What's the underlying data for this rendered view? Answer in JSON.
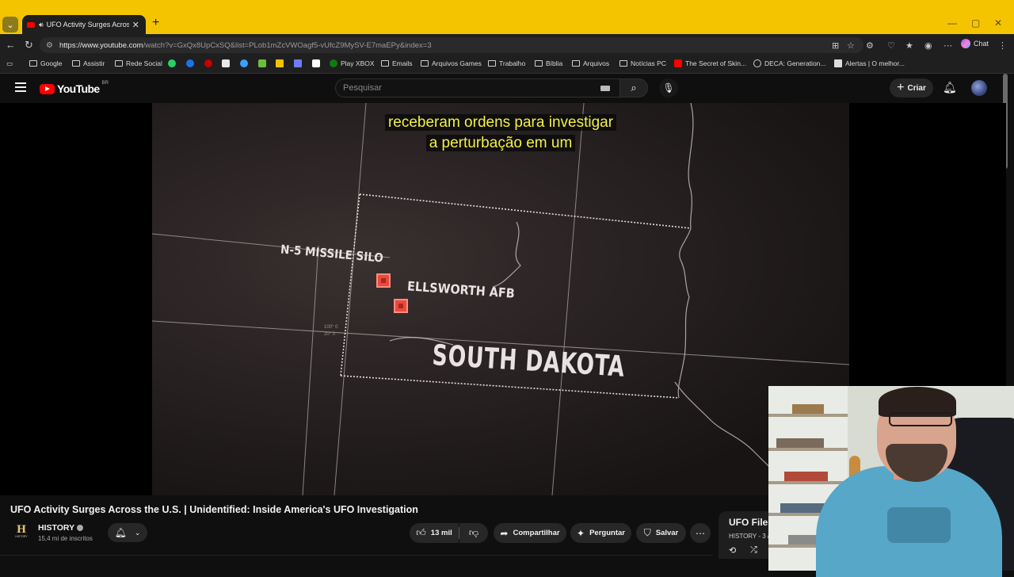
{
  "browser": {
    "tab_title": "UFO Activity Surges Across the",
    "tab_close": "✕",
    "new_tab": "+",
    "url_host": "https://www.youtube.com",
    "url_path": "/watch?v=GxQx8UpCxSQ&list=PLob1mZcVWOagf5-vUfcZ9MySV-E7maEPy&index=3",
    "chat_label": "Chat",
    "bookmarks": [
      {
        "label": "Google"
      },
      {
        "label": "Assistir"
      },
      {
        "label": "Rede Social"
      },
      {
        "label": "Play XBOX"
      },
      {
        "label": "Emails"
      },
      {
        "label": "Arquivos Games"
      },
      {
        "label": "Trabalho"
      },
      {
        "label": "Bíblia"
      },
      {
        "label": "Arquivos"
      },
      {
        "label": "Notícias PC"
      },
      {
        "label": "The Secret of Skin..."
      },
      {
        "label": "DECA: Generation..."
      },
      {
        "label": "Alertas | O melhor..."
      }
    ],
    "colors": {
      "frame": "#f5c400",
      "toolbar": "#1f1f1f"
    }
  },
  "youtube": {
    "logo_text": "YouTube",
    "logo_region": "BR",
    "search_placeholder": "Pesquisar",
    "create_label": "Criar"
  },
  "video": {
    "subtitle_line1": "receberam ordens para investigar",
    "subtitle_line2": "a perturbação em um",
    "map_labels": {
      "silo": "N-5 MISSILE SILO",
      "afb": "ELLSWORTH AFB",
      "state": "SOUTH DAKOTA",
      "coord1": "100° 0",
      "coord2": "20° 0"
    },
    "title": "UFO Activity Surges Across the U.S. | Unidentified: Inside America's UFO Investigation"
  },
  "channel": {
    "logo_letter": "H",
    "logo_small": "HISTORY",
    "name": "HISTORY",
    "subscribers": "15,4 mi de inscritos"
  },
  "actions": {
    "likes": "13 mil",
    "share": "Compartilhar",
    "ask": "Perguntar",
    "save": "Salvar"
  },
  "playlist": {
    "title": "UFO File",
    "subtitle": "HISTORY - 3 /"
  }
}
